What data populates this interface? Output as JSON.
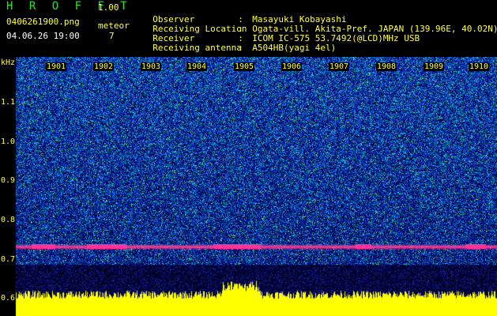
{
  "header": {
    "app_name": "HROFFT",
    "version": "1.00",
    "file": "0406261900.png",
    "meteor_label": "meteor",
    "timestamp": "04.06.26 19:00",
    "meteor_count": "7"
  },
  "info": [
    {
      "key": "Observer",
      "value": "Masayuki Kobayashi"
    },
    {
      "key": "Receiving Location",
      "value": "Ogata-vill. Akita-Pref. JAPAN (139.96E, 40.02N)"
    },
    {
      "key": "Receiver",
      "value": "ICOM IC-575 53.7492(@LCD)MHz USB"
    },
    {
      "key": "Receiving antenna",
      "value": "A504HB(yagi 4el)"
    }
  ],
  "axis": {
    "unit": "kHz",
    "freq_ticks": [
      "1.1",
      "1.0",
      "0.9",
      "0.8",
      "0.7",
      "0.6"
    ],
    "time_ticks": [
      "1901",
      "1902",
      "1903",
      "1904",
      "1905",
      "1906",
      "1907",
      "1908",
      "1909",
      "1910"
    ]
  },
  "colors": {
    "title": "#2fe02f",
    "label": "#ffff40",
    "echo_line": "#ff3399",
    "background_noise": "#1030a0"
  }
}
